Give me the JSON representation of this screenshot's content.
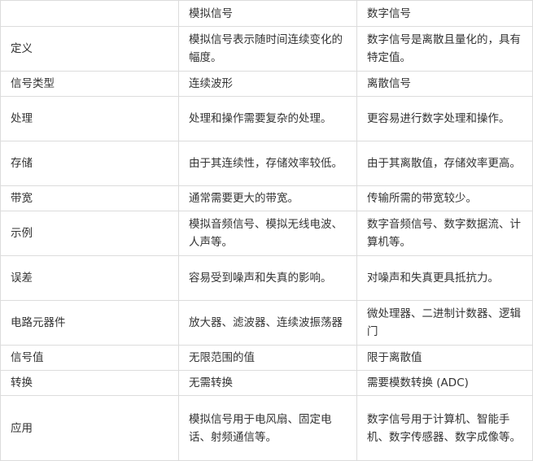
{
  "table": {
    "headers": [
      "",
      "模拟信号",
      "数字信号"
    ],
    "rows": [
      {
        "label": "定义",
        "analog": "模拟信号表示随时间连续变化的幅度。",
        "digital": "数字信号是离散且量化的，具有特定值。"
      },
      {
        "label": "信号类型",
        "analog": "连续波形",
        "digital": "离散信号"
      },
      {
        "label": "处理",
        "analog": "处理和操作需要复杂的处理。",
        "digital": "更容易进行数字处理和操作。"
      },
      {
        "label": "存储",
        "analog": "由于其连续性，存储效率较低。",
        "digital": "由于其离散值，存储效率更高。"
      },
      {
        "label": "带宽",
        "analog": "通常需要更大的带宽。",
        "digital": "传输所需的带宽较少。"
      },
      {
        "label": "示例",
        "analog": "模拟音频信号、模拟无线电波、人声等。",
        "digital": "数字音频信号、数字数据流、计算机等。"
      },
      {
        "label": "误差",
        "analog": "容易受到噪声和失真的影响。",
        "digital": "对噪声和失真更具抵抗力。"
      },
      {
        "label": "电路元器件",
        "analog": "放大器、滤波器、连续波振荡器",
        "digital": "微处理器、二进制计数器、逻辑门"
      },
      {
        "label": "信号值",
        "analog": "无限范围的值",
        "digital": "限于离散值"
      },
      {
        "label": "转换",
        "analog": "无需转换",
        "digital": "需要模数转换 (ADC)"
      },
      {
        "label": "应用",
        "analog": "模拟信号用于电风扇、固定电话、射频通信等。",
        "digital": "数字信号用于计算机、智能手机、数字传感器、数字成像等。"
      }
    ]
  }
}
